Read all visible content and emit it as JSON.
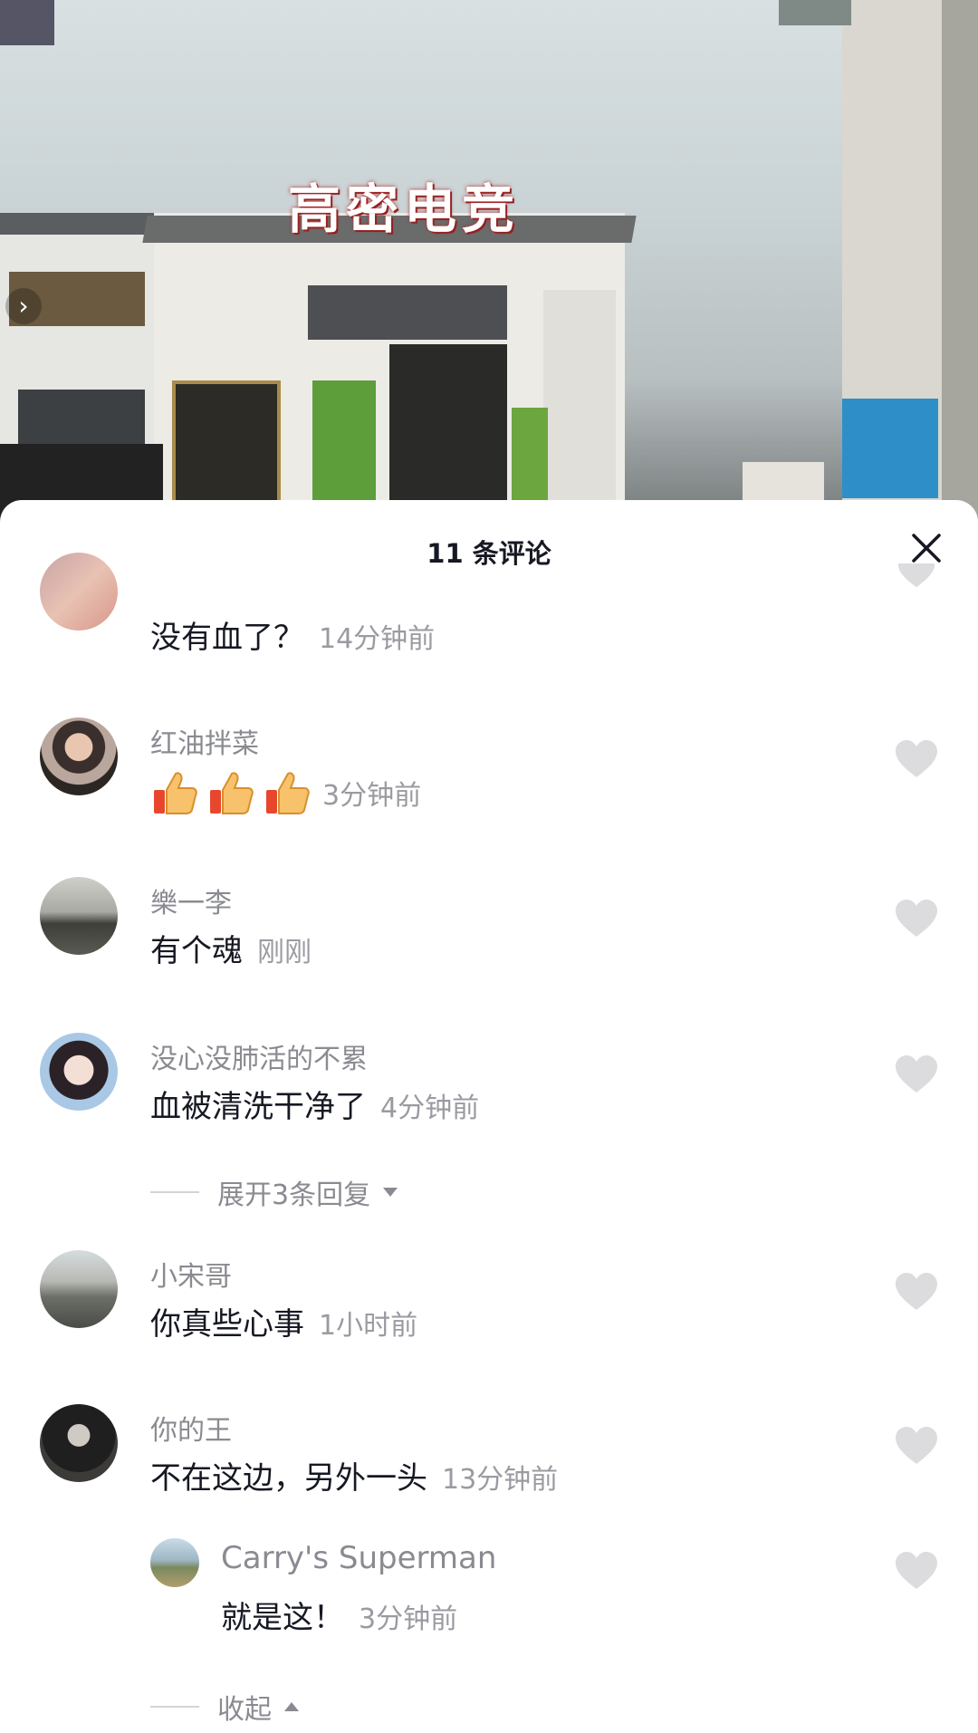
{
  "video": {
    "sign_text": "高密电竞"
  },
  "sheet": {
    "title": "11 条评论",
    "close_icon": "close-icon"
  },
  "comments": [
    {
      "nickname": "",
      "text": "没有血了？",
      "time": "14分钟前"
    },
    {
      "nickname": "红油拌菜",
      "text": "",
      "emojis": [
        "thumbs-up",
        "thumbs-up",
        "thumbs-up"
      ],
      "time": "3分钟前"
    },
    {
      "nickname": "樂一李",
      "text": "有个魂",
      "time": "刚刚"
    },
    {
      "nickname": "没心没肺活的不累",
      "text": "血被清洗干净了",
      "time": "4分钟前",
      "expand_label": "展开3条回复"
    },
    {
      "nickname": "小宋哥",
      "text": "你真些心事",
      "time": "1小时前"
    },
    {
      "nickname": "你的王",
      "text": "不在这边，另外一头",
      "time": "13分钟前"
    }
  ],
  "reply": {
    "nickname": "Carry's  Superman",
    "text": "就是这！",
    "time": "3分钟前"
  },
  "collapse_label": "收起",
  "colors": {
    "text": "#161823",
    "muted": "#8a8b91",
    "heart": "#dcdcde"
  }
}
